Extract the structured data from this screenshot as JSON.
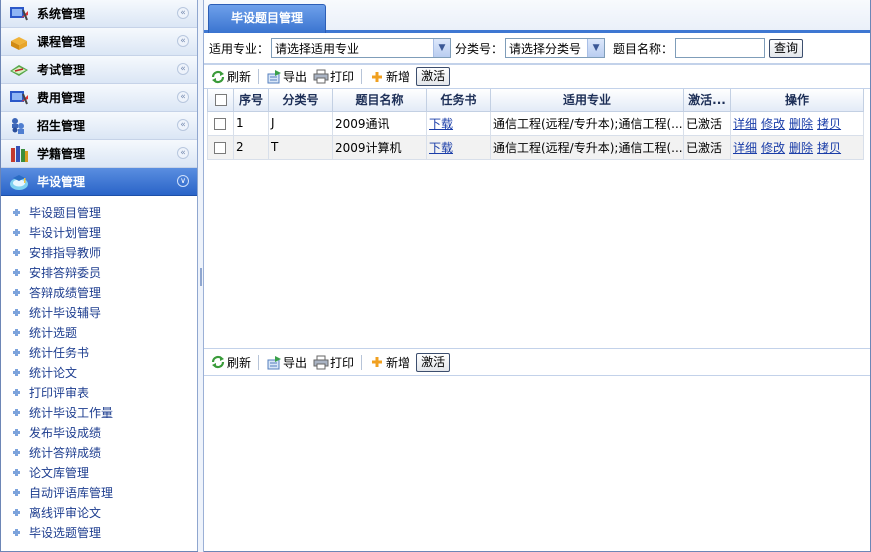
{
  "sidebar": {
    "sections": [
      {
        "label": "系统管理",
        "icon": "system-icon"
      },
      {
        "label": "课程管理",
        "icon": "course-icon"
      },
      {
        "label": "考试管理",
        "icon": "exam-icon"
      },
      {
        "label": "费用管理",
        "icon": "fee-icon"
      },
      {
        "label": "招生管理",
        "icon": "enroll-icon"
      },
      {
        "label": "学籍管理",
        "icon": "books-icon"
      },
      {
        "label": "毕设管理",
        "icon": "graduation-icon"
      }
    ],
    "items": [
      "毕设题目管理",
      "毕设计划管理",
      "安排指导教师",
      "安排答辩委员",
      "答辩成绩管理",
      "统计毕设辅导",
      "统计选题",
      "统计任务书",
      "统计论文",
      "打印评审表",
      "统计毕设工作量",
      "发布毕设成绩",
      "统计答辩成绩",
      "论文库管理",
      "自动评语库管理",
      "离线评审论文",
      "毕设选题管理"
    ]
  },
  "tab": {
    "label": "毕设题目管理"
  },
  "filter": {
    "major_label": "适用专业：",
    "major_value": "请选择适用专业",
    "category_label": "分类号：",
    "category_value": "请选择分类号",
    "title_label": "题目名称：",
    "title_value": "",
    "query_button": "查询"
  },
  "toolbar": {
    "refresh": "刷新",
    "export": "导出",
    "print": "打印",
    "add": "新增",
    "activate": "激活"
  },
  "table": {
    "headers": [
      "序号",
      "分类号",
      "题目名称",
      "任务书",
      "适用专业",
      "激活...",
      "操作"
    ],
    "rows": [
      {
        "no": "1",
        "category": "J",
        "title": "2009通讯",
        "task": "下载",
        "major": "通信工程(远程/专升本);通信工程(...",
        "status": "已激活",
        "ops": [
          "详细",
          "修改",
          "删除",
          "拷贝"
        ]
      },
      {
        "no": "2",
        "category": "T",
        "title": "2009计算机",
        "task": "下载",
        "major": "通信工程(远程/专升本);通信工程(...",
        "status": "已激活",
        "ops": [
          "详细",
          "修改",
          "删除",
          "拷贝"
        ]
      }
    ]
  },
  "colors": {
    "accent": "#3e77d2",
    "link": "#1a3da8"
  }
}
